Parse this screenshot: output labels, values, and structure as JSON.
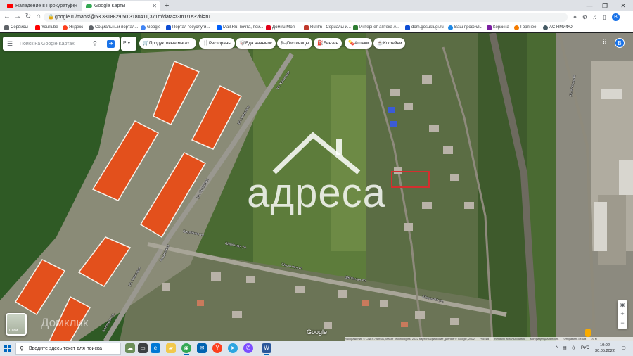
{
  "browser": {
    "tabs": [
      {
        "title": "Нападение в Прокуратуре",
        "favicon_color": "#ff0000",
        "active": false
      },
      {
        "title": "Google Карты",
        "favicon_color": "#34a853",
        "active": true
      }
    ],
    "url": "google.ru/maps/@53.3318829,50.3180411,371m/data=!3m1!1e3?hl=ru",
    "profile_initial": "B"
  },
  "bookmarks": [
    {
      "label": "Сервисы",
      "color": "#5f6368"
    },
    {
      "label": "YouTube",
      "color": "#ff0000"
    },
    {
      "label": "Яндекс",
      "color": "#fc3f1d"
    },
    {
      "label": "Социальный портал...",
      "color": "#5f6368"
    },
    {
      "label": "Google",
      "color": "#4285f4"
    },
    {
      "label": "Портал госуслуги...",
      "color": "#0d4cd3"
    },
    {
      "label": "Mail.Ru: почта, пои...",
      "color": "#005ff9"
    },
    {
      "label": "Дом.ru Моя",
      "color": "#e10019"
    },
    {
      "label": "Rufilm - Сериалы и...",
      "color": "#c0392b"
    },
    {
      "label": "Интернет-аптека А...",
      "color": "#2e7d32"
    },
    {
      "label": "dom.gosuslugi.ru",
      "color": "#0d4cd3"
    },
    {
      "label": "Ваш профиль",
      "color": "#1e88e5"
    },
    {
      "label": "Корзина",
      "color": "#7b1fa2"
    },
    {
      "label": "Горячее",
      "color": "#f57c00"
    },
    {
      "label": "АС НМИФО",
      "color": "#455a64"
    }
  ],
  "map": {
    "search_placeholder": "Поиск на Google Картах",
    "mode_label": "Р",
    "chips": [
      {
        "label": "Продуктовые магаз...",
        "icon": "cart-icon",
        "glyph": "🛒"
      },
      {
        "label": "Рестораны",
        "icon": "fork-knife-icon",
        "glyph": "🍴"
      },
      {
        "label": "Еда навынос",
        "icon": "takeout-icon",
        "glyph": "🥡"
      },
      {
        "label": "Гостиницы",
        "icon": "bed-icon",
        "glyph": "🛏"
      },
      {
        "label": "Бензин",
        "icon": "fuel-icon",
        "glyph": "⛽"
      },
      {
        "label": "Аптеки",
        "icon": "pharmacy-icon",
        "glyph": "💊"
      },
      {
        "label": "Кофейни",
        "icon": "coffee-icon",
        "glyph": "☕"
      }
    ],
    "profile_initial": "B",
    "layers_label": "Слои",
    "watermark": "адреса",
    "watermark2": "Домклик",
    "google_logo": "Google",
    "street_labels": [
      "ул. Кленовая",
      "ул. Кленовая",
      "ул. Ясеневая",
      "Рощинская",
      "ул. Кленовая",
      "Кленовая ул.",
      "Школьная ул.",
      "Школьная ул.",
      "Школьная ул.",
      "Школьная ул.",
      "Школьная ул.",
      "ул. Кленовая"
    ],
    "attribution": [
      "Изображения © CNES / Airbus, Maxar Technologies, 2022 Картографические данные © Google, 2022",
      "Россия",
      "Условия использования",
      "Конфиденциальность",
      "Отправить отзыв",
      "20 м"
    ],
    "highlight_color": "#d32f2f"
  },
  "taskbar": {
    "search_placeholder": "Введите здесь текст для поиска",
    "language": "РУС",
    "time": "10:02",
    "date": "30.05.2022"
  }
}
